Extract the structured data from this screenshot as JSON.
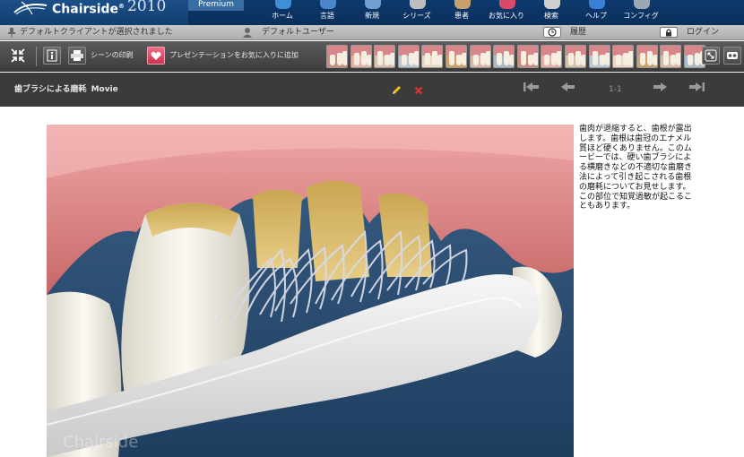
{
  "header": {
    "brand": "Chairside",
    "trademark": "®",
    "year": "2010",
    "edition": "Premium",
    "nav": [
      {
        "label": "ホーム",
        "icon": "home-icon",
        "color": "#3f8fd6"
      },
      {
        "label": "言語",
        "icon": "language-icon",
        "color": "#4a86c9"
      },
      {
        "label": "新規",
        "icon": "new-icon",
        "color": "#6fa0cf"
      },
      {
        "label": "シリーズ",
        "icon": "series-icon",
        "color": "#bdbdbd"
      },
      {
        "label": "患者",
        "icon": "patient-icon",
        "color": "#c8a06b"
      },
      {
        "label": "お気に入り",
        "icon": "favorites-icon",
        "color": "#d94a6a"
      },
      {
        "label": "検索",
        "icon": "search-icon",
        "color": "#cfcfcf"
      },
      {
        "label": "ヘルプ",
        "icon": "help-icon",
        "color": "#3a7fd4"
      },
      {
        "label": "コンフィグ",
        "icon": "config-icon",
        "color": "#9aa7b5"
      }
    ]
  },
  "status": {
    "client": "デフォルトクライアントが選択されました",
    "user": "デフォルトユーザー",
    "history": "履歴",
    "login": "ログイン"
  },
  "toolbar": {
    "print_scene": "シーンの印刷",
    "add_favorite": "プレゼンテーションをお気に入りに追加",
    "thumb_count": 16
  },
  "title": {
    "name": "歯ブラシによる磨耗",
    "type": "Movie",
    "page": "1-1"
  },
  "scene": {
    "watermark": "Chairside"
  },
  "description": "歯肉が退縮すると、歯根が露出します。歯根は歯冠のエナメル質ほど硬くありません。このムービーでは、硬い歯ブラシによる横磨きなどの不適切な歯磨き法によって引き起こされる歯根の磨耗についてお見せします。この部位で知覚過敏が起こることもあります。"
}
